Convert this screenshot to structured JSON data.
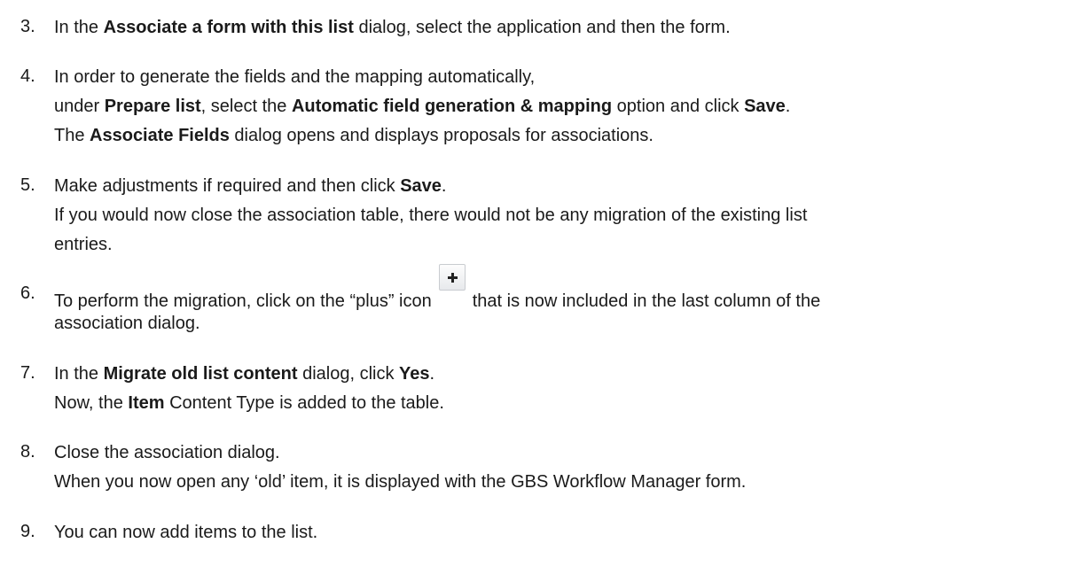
{
  "steps": [
    {
      "number": "3.",
      "lines": [
        [
          {
            "t": "In the "
          },
          {
            "t": "Associate a form with this list",
            "b": true
          },
          {
            "t": " dialog, select the application and then the form."
          }
        ]
      ]
    },
    {
      "number": "4.",
      "lines": [
        [
          {
            "t": "In order to generate the fields and the mapping automatically,"
          }
        ],
        [
          {
            "t": "under "
          },
          {
            "t": "Prepare list",
            "b": true
          },
          {
            "t": ", select the "
          },
          {
            "t": "Automatic field generation & mapping",
            "b": true
          },
          {
            "t": " option and click "
          },
          {
            "t": "Save",
            "b": true
          },
          {
            "t": "."
          }
        ],
        [
          {
            "t": "The "
          },
          {
            "t": "Associate Fields",
            "b": true
          },
          {
            "t": " dialog opens and displays proposals for associations."
          }
        ]
      ]
    },
    {
      "number": "5.",
      "lines": [
        [
          {
            "t": "Make adjustments if required and then click "
          },
          {
            "t": "Save",
            "b": true
          },
          {
            "t": "."
          }
        ],
        [
          {
            "t": "If you would now close the association table, there would not be any migration of the existing list"
          }
        ],
        [
          {
            "t": "entries."
          }
        ]
      ]
    },
    {
      "number": "6.",
      "lines": [
        [
          {
            "t": "To perform the migration, click on the “plus” icon"
          },
          {
            "icon": "plus-icon"
          },
          {
            "t": "that is now included in the last column of the"
          }
        ],
        [
          {
            "t": "association dialog."
          }
        ]
      ]
    },
    {
      "number": "7.",
      "lines": [
        [
          {
            "t": "In the "
          },
          {
            "t": "Migrate old list content",
            "b": true
          },
          {
            "t": " dialog, click "
          },
          {
            "t": "Yes",
            "b": true
          },
          {
            "t": "."
          }
        ],
        [
          {
            "t": "Now, the "
          },
          {
            "t": "Item",
            "b": true
          },
          {
            "t": " Content Type is added to the table."
          }
        ]
      ]
    },
    {
      "number": "8.",
      "lines": [
        [
          {
            "t": "Close the association dialog."
          }
        ],
        [
          {
            "t": "When you now open any ‘old’ item, it is displayed with the GBS Workflow Manager form."
          }
        ]
      ]
    },
    {
      "number": "9.",
      "lines": [
        [
          {
            "t": "You can now add items to the list."
          }
        ]
      ]
    }
  ]
}
